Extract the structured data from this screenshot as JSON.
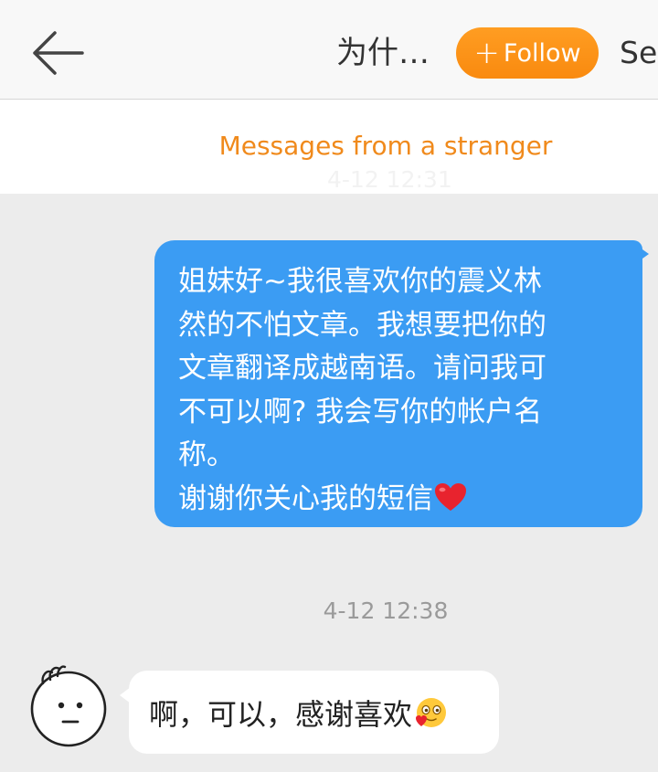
{
  "header": {
    "title": "为什…",
    "follow_plus": "+",
    "follow_label": "Follow",
    "settings_label": "Se",
    "accent_color": "#f98a0f"
  },
  "banner": {
    "text": "Messages from a stranger",
    "color": "#f08a1c",
    "faded_time": "4-12 12:31"
  },
  "messages": [
    {
      "direction": "outgoing",
      "bubble_color": "#3b9cf3",
      "lines": [
        "姐妹好~我很喜欢你的震义林",
        "然的不怕文章。我想要把你的",
        "文章翻译成越南语。请问我可",
        "不可以啊? 我会写你的帐户名",
        "称。",
        "谢谢你关心我的短信"
      ],
      "trailing_icon": "red-heart-icon"
    },
    {
      "direction": "incoming",
      "time": "4-12 12:38",
      "avatar_icon": "doodle-face-avatar",
      "text": "啊，可以，感谢喜欢",
      "trailing_icon": "smiling-face-with-hearts-emoji"
    }
  ]
}
